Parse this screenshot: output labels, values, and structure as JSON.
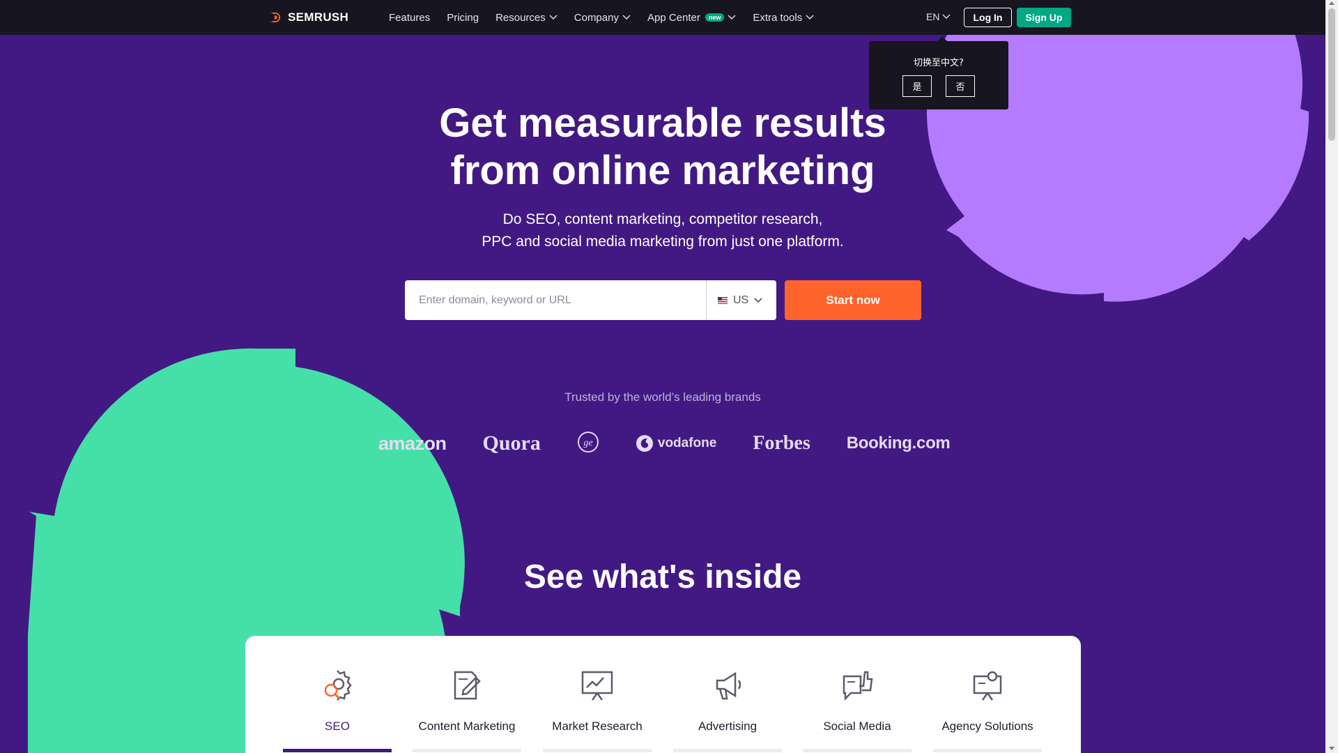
{
  "header": {
    "logo_text": "SEMRUSH",
    "nav": [
      {
        "label": "Features",
        "dropdown": false
      },
      {
        "label": "Pricing",
        "dropdown": false
      },
      {
        "label": "Resources",
        "dropdown": true
      },
      {
        "label": "Company",
        "dropdown": true
      },
      {
        "label": "App Center",
        "dropdown": true,
        "badge": "new"
      },
      {
        "label": "Extra tools",
        "dropdown": true
      }
    ],
    "language": "EN",
    "login_label": "Log In",
    "signup_label": "Sign Up"
  },
  "lang_popup": {
    "question": "切换至中文?",
    "yes_label": "是",
    "no_label": "否"
  },
  "hero": {
    "title_line1": "Get measurable results",
    "title_line2": "from online marketing",
    "subtitle_line1": "Do SEO, content marketing, competitor research,",
    "subtitle_line2": "PPC and social media marketing from just one platform.",
    "search_placeholder": "Enter domain, keyword or URL",
    "database": "US",
    "cta_label": "Start now"
  },
  "trusted": {
    "label": "Trusted by the world’s leading brands",
    "brands": [
      "amazon",
      "Quora",
      "GE",
      "vodafone",
      "Forbes",
      "Booking.com"
    ]
  },
  "inside": {
    "title": "See what's inside",
    "tabs": [
      {
        "label": "SEO",
        "icon": "seo-icon",
        "active": true
      },
      {
        "label": "Content Marketing",
        "icon": "content-marketing-icon",
        "active": false
      },
      {
        "label": "Market Research",
        "icon": "market-research-icon",
        "active": false
      },
      {
        "label": "Advertising",
        "icon": "advertising-icon",
        "active": false
      },
      {
        "label": "Social Media",
        "icon": "social-media-icon",
        "active": false
      },
      {
        "label": "Agency Solutions",
        "icon": "agency-solutions-icon",
        "active": false
      }
    ]
  },
  "colors": {
    "background": "#421983",
    "topbar": "#17151f",
    "accent_orange": "#ff642d",
    "accent_green": "#00a884",
    "circle_purple": "#b57bff",
    "circle_green": "#45e0a8"
  }
}
